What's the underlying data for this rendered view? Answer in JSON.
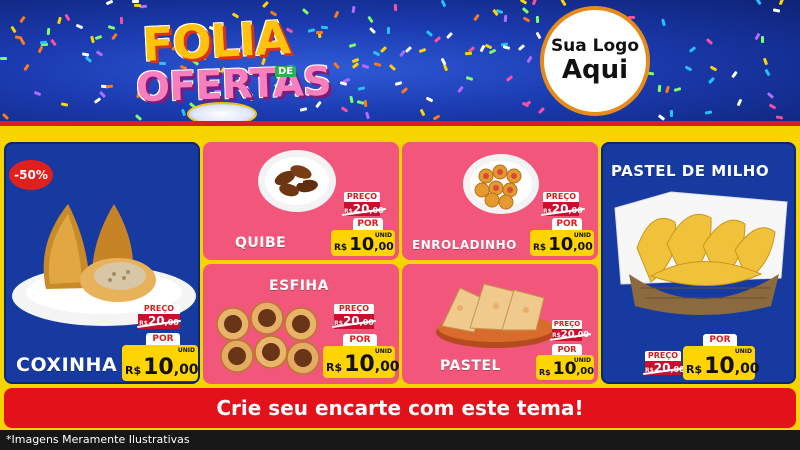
{
  "header": {
    "logo_line1": "FOLIA",
    "logo_de": "DE",
    "logo_line2": "OFERTAS",
    "brand_line1": "Sua Logo",
    "brand_line2": "Aqui"
  },
  "products": {
    "coxinha": {
      "name": "COXINHA",
      "badge": "-50%",
      "preco_label": "PREÇO",
      "old_currency": "R$",
      "old_int": "20",
      "old_cents": ",00",
      "por_label": "POR",
      "currency": "R$",
      "int": "10",
      "cents": ",00",
      "unit": "UNID"
    },
    "quibe": {
      "name": "QUIBE",
      "preco_label": "PREÇO",
      "old_currency": "R$",
      "old_int": "20",
      "old_cents": ",00",
      "por_label": "POR",
      "currency": "R$",
      "int": "10",
      "cents": ",00",
      "unit": "UNID"
    },
    "enroladinho": {
      "name": "ENROLADINHO",
      "preco_label": "PREÇO",
      "old_currency": "R$",
      "old_int": "20",
      "old_cents": ",00",
      "por_label": "POR",
      "currency": "R$",
      "int": "10",
      "cents": ",00",
      "unit": "UNID"
    },
    "esfiha": {
      "name": "ESFIHA",
      "preco_label": "PREÇO",
      "old_currency": "R$",
      "old_int": "20",
      "old_cents": ",00",
      "por_label": "POR",
      "currency": "R$",
      "int": "10",
      "cents": ",00",
      "unit": "UNID"
    },
    "pastel": {
      "name": "PASTEL",
      "preco_label": "PREÇO",
      "old_currency": "R$",
      "old_int": "20",
      "old_cents": ",00",
      "por_label": "POR",
      "currency": "R$",
      "int": "10",
      "cents": ",00",
      "unit": "UNID"
    },
    "pastel_milho": {
      "name": "PASTEL DE MILHO",
      "preco_label": "PREÇO",
      "old_currency": "R$",
      "old_int": "20",
      "old_cents": ",00",
      "por_label": "POR",
      "currency": "R$",
      "int": "10",
      "cents": ",00",
      "unit": "UNID"
    }
  },
  "cta": {
    "text": "Crie seu encarte com este tema!"
  },
  "footer": {
    "disclaimer": "*Imagens Meramente Ilustrativas"
  },
  "colors": {
    "page_bg": "#f7d400",
    "header_blue": "#1b3bb0",
    "panel_blue": "#163aa0",
    "panel_pink": "#f2577b",
    "accent_red": "#e3111a",
    "price_yellow": "#ffd400"
  }
}
